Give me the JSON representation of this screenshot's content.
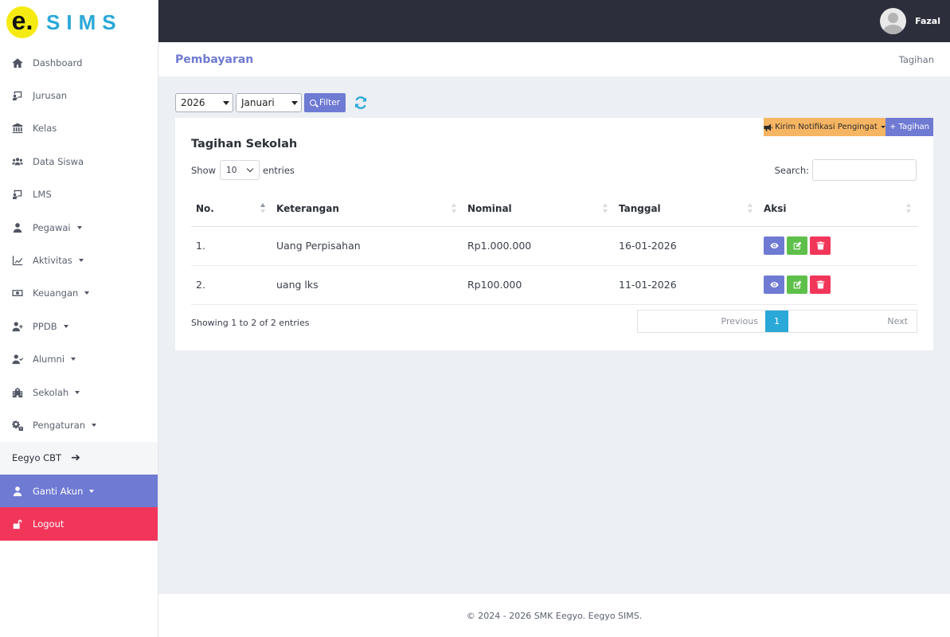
{
  "brand": {
    "letter": "e.",
    "name": "SIMS"
  },
  "user": {
    "name": "Fazal"
  },
  "sidebar": {
    "items": [
      {
        "label": "Dashboard",
        "icon": "home-icon"
      },
      {
        "label": "Jurusan",
        "icon": "chalkboard-icon"
      },
      {
        "label": "Kelas",
        "icon": "building-columns-icon"
      },
      {
        "label": "Data Siswa",
        "icon": "users-icon"
      },
      {
        "label": "LMS",
        "icon": "chalkboard-teacher-icon"
      },
      {
        "label": "Pegawai",
        "icon": "user-icon",
        "dropdown": true
      },
      {
        "label": "Aktivitas",
        "icon": "chart-line-icon",
        "dropdown": true
      },
      {
        "label": "Keuangan",
        "icon": "money-bill-icon",
        "dropdown": true
      },
      {
        "label": "PPDB",
        "icon": "user-plus-icon",
        "dropdown": true
      },
      {
        "label": "Alumni",
        "icon": "user-check-icon",
        "dropdown": true
      },
      {
        "label": "Sekolah",
        "icon": "school-icon",
        "dropdown": true
      },
      {
        "label": "Pengaturan",
        "icon": "gears-icon",
        "dropdown": true
      }
    ],
    "cbt": {
      "label": "Eegyo CBT",
      "icon": "arrow-right-icon"
    },
    "ganti_akun": {
      "label": "Ganti Akun",
      "icon": "user-icon"
    },
    "logout": {
      "label": "Logout",
      "icon": "unlock-icon"
    }
  },
  "header": {
    "title": "Pembayaran",
    "breadcrumb": "Tagihan"
  },
  "filters": {
    "year": "2026",
    "month": "Januari",
    "filter_label": "Filter",
    "refresh_icon": "sync-icon"
  },
  "card": {
    "title": "Tagihan Sekolah",
    "notif_label": "Kirim Notifikasi Pengingat",
    "add_label": "+ Tagihan",
    "show_label": "Show",
    "page_length": "10",
    "entries_label": "entries",
    "search_label": "Search:",
    "search_value": "",
    "columns": [
      "No.",
      "Keterangan",
      "Nominal",
      "Tanggal",
      "Aksi"
    ],
    "rows": [
      {
        "no": "1.",
        "keterangan": "Uang Perpisahan",
        "nominal": "Rp1.000.000",
        "tanggal": "16-01-2026"
      },
      {
        "no": "2.",
        "keterangan": "uang lks",
        "nominal": "Rp100.000",
        "tanggal": "11-01-2026"
      }
    ],
    "info": "Showing 1 to 2 of 2 entries",
    "pagination": {
      "previous": "Previous",
      "current": "1",
      "next": "Next"
    }
  },
  "footer": {
    "text": "© 2024 - 2026 SMK Eegyo. Eegyo SIMS."
  },
  "colors": {
    "primary": "#6f7ad3",
    "topbar": "#2c2f3b",
    "danger": "#f2365a",
    "success": "#5ec04a",
    "warning": "#f6b562",
    "info": "#2aa8d8",
    "brand_yellow": "#f5eb12"
  }
}
